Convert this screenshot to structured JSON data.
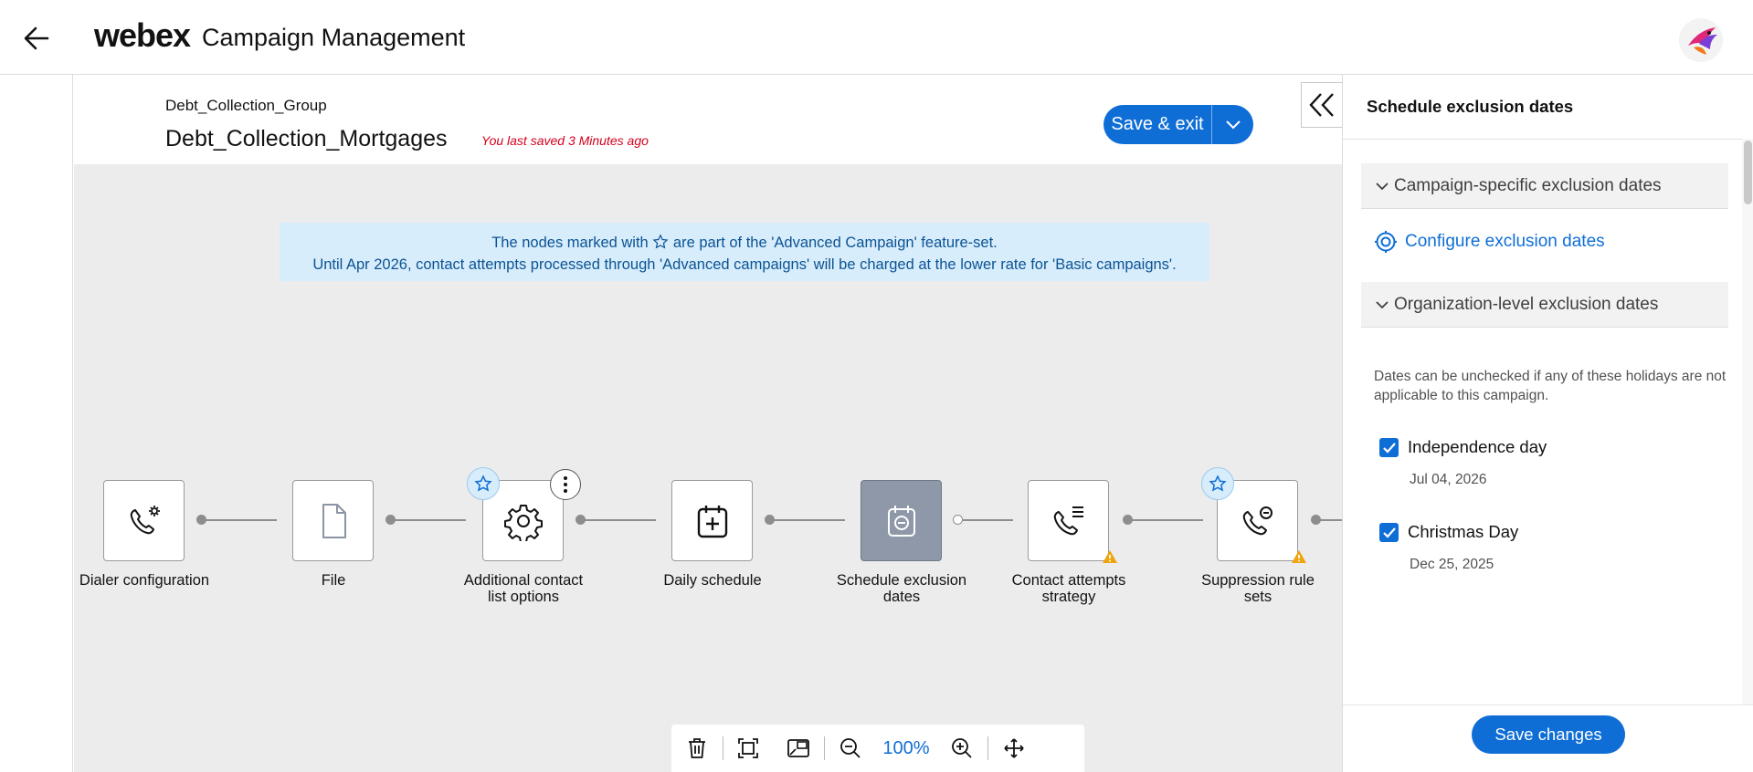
{
  "header": {
    "brand": "webex",
    "app_name": "Campaign Management"
  },
  "campaign": {
    "group": "Debt_Collection_Group",
    "name": "Debt_Collection_Mortgages",
    "saved_status": "You last saved 3 Minutes ago",
    "save_exit_label": "Save & exit"
  },
  "banner": {
    "line1_before": "The nodes marked with",
    "line1_after": "are part of the 'Advanced Campaign' feature-set.",
    "line2": "Until Apr 2026, contact attempts processed through 'Advanced campaigns' will be charged at the lower rate for 'Basic campaigns'."
  },
  "flow": {
    "nodes": [
      {
        "label": "Dialer configuration",
        "icon": "phone-gear-icon"
      },
      {
        "label": "File",
        "icon": "file-icon"
      },
      {
        "label": "Additional contact list options",
        "icon": "gear-icon",
        "advanced": true
      },
      {
        "label": "Daily schedule",
        "icon": "calendar-add-icon"
      },
      {
        "label": "Schedule exclusion dates",
        "icon": "calendar-minus-icon",
        "active": true
      },
      {
        "label": "Contact attempts strategy",
        "icon": "phone-list-icon",
        "warning": true
      },
      {
        "label": "Suppression rule sets",
        "icon": "phone-minus-icon",
        "advanced": true,
        "warning": true
      }
    ]
  },
  "toolbar": {
    "zoom": "100%",
    "icons": [
      "trash-icon",
      "fit-screen-icon",
      "minimap-icon",
      "zoom-out-icon",
      "zoom-in-icon",
      "pan-icon"
    ]
  },
  "panel": {
    "title": "Schedule exclusion dates",
    "campaign_section": "Campaign-specific exclusion dates",
    "configure_link": "Configure exclusion dates",
    "org_section": "Organization-level exclusion dates",
    "note": "Dates can be unchecked if any of these holidays are not applicable to this campaign.",
    "holidays": [
      {
        "name": "Independence day",
        "date": "Jul 04, 2026",
        "checked": true
      },
      {
        "name": "Christmas Day",
        "date": "Dec 25, 2025",
        "checked": true
      }
    ],
    "save_label": "Save changes"
  },
  "colors": {
    "accent": "#0f6ed6",
    "saved_status": "#d4001c",
    "banner_bg": "#d8edfb",
    "warning": "#f0a30a"
  }
}
